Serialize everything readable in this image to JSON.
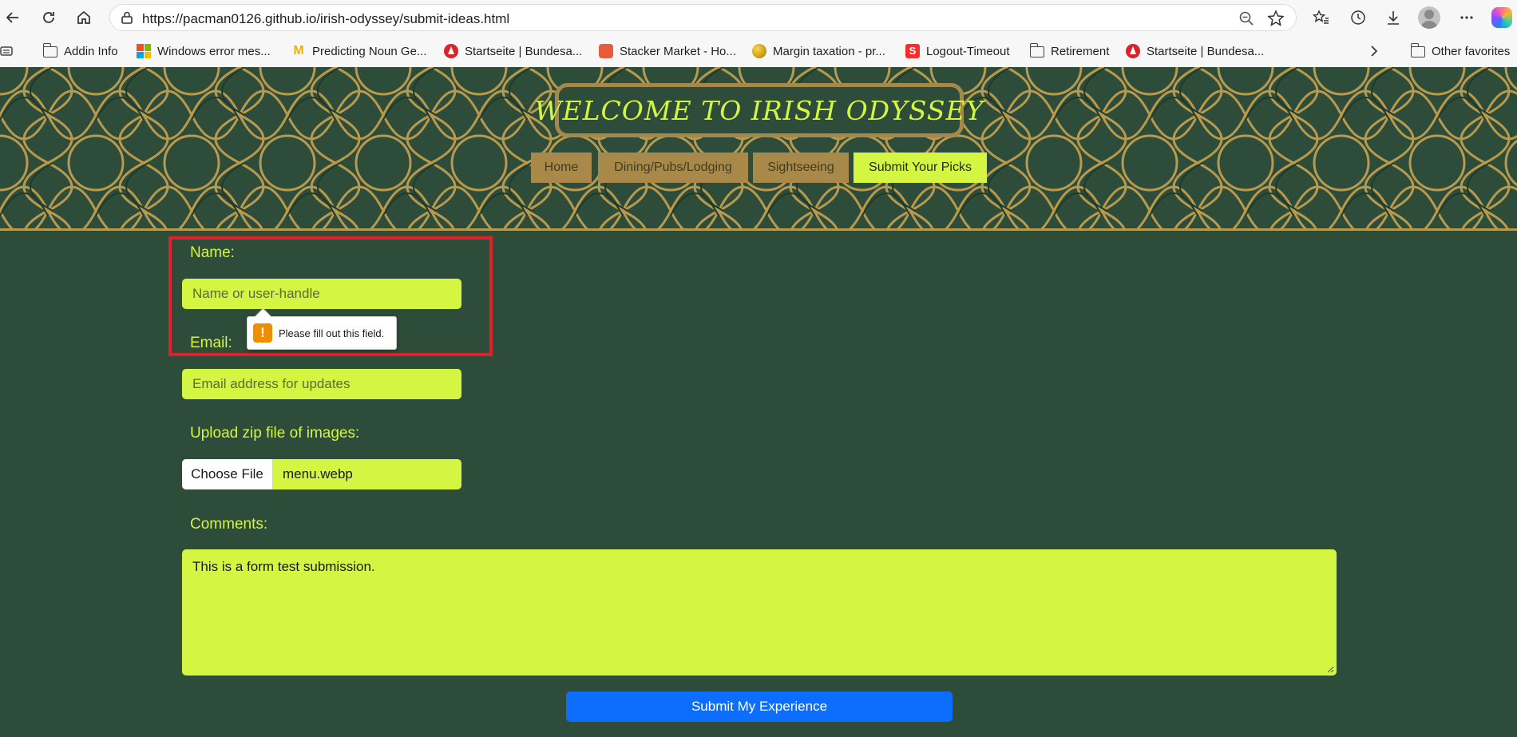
{
  "browser": {
    "url": "https://pacman0126.github.io/irish-odyssey/submit-ideas.html",
    "favorites": [
      {
        "label": "Addin Info",
        "icon": "folder-icon"
      },
      {
        "label": "Windows error mes...",
        "icon": "microsoft-icon"
      },
      {
        "label": "Predicting Noun Ge...",
        "icon": "m-logo-icon"
      },
      {
        "label": "Startseite | Bundesa...",
        "icon": "arbeitsagentur-icon"
      },
      {
        "label": "Stacker Market - Ho...",
        "icon": "stacker-icon"
      },
      {
        "label": "Margin taxation - pr...",
        "icon": "coin-icon"
      },
      {
        "label": "Logout-Timeout",
        "icon": "sparkasse-icon"
      },
      {
        "label": "Retirement",
        "icon": "folder-icon"
      },
      {
        "label": "Startseite | Bundesa...",
        "icon": "arbeitsagentur-icon"
      }
    ],
    "other_favorites": "Other favorites"
  },
  "site": {
    "title": "WELCOME TO IRISH ODYSSEY",
    "nav": [
      {
        "label": "Home",
        "active": false
      },
      {
        "label": "Dining/Pubs/Lodging",
        "active": false
      },
      {
        "label": "Sightseeing",
        "active": false
      },
      {
        "label": "Submit Your Picks",
        "active": true
      }
    ]
  },
  "form": {
    "name_label": "Name:",
    "name_placeholder": "Name or user-handle",
    "validation_message": "Please fill out this field.",
    "email_label": "Email:",
    "email_placeholder": "Email address for updates",
    "upload_label": "Upload zip file of images:",
    "choose_file_label": "Choose File",
    "file_name": "menu.webp",
    "comments_label": "Comments:",
    "comments_value": "This is a form test submission.",
    "submit_label": "Submit My Experience"
  },
  "colors": {
    "page_bg": "#2e4c3a",
    "accent_lime": "#d4f542",
    "gold": "#a8894a",
    "submit_blue": "#0d6efd",
    "highlight_red": "#e0202a"
  }
}
